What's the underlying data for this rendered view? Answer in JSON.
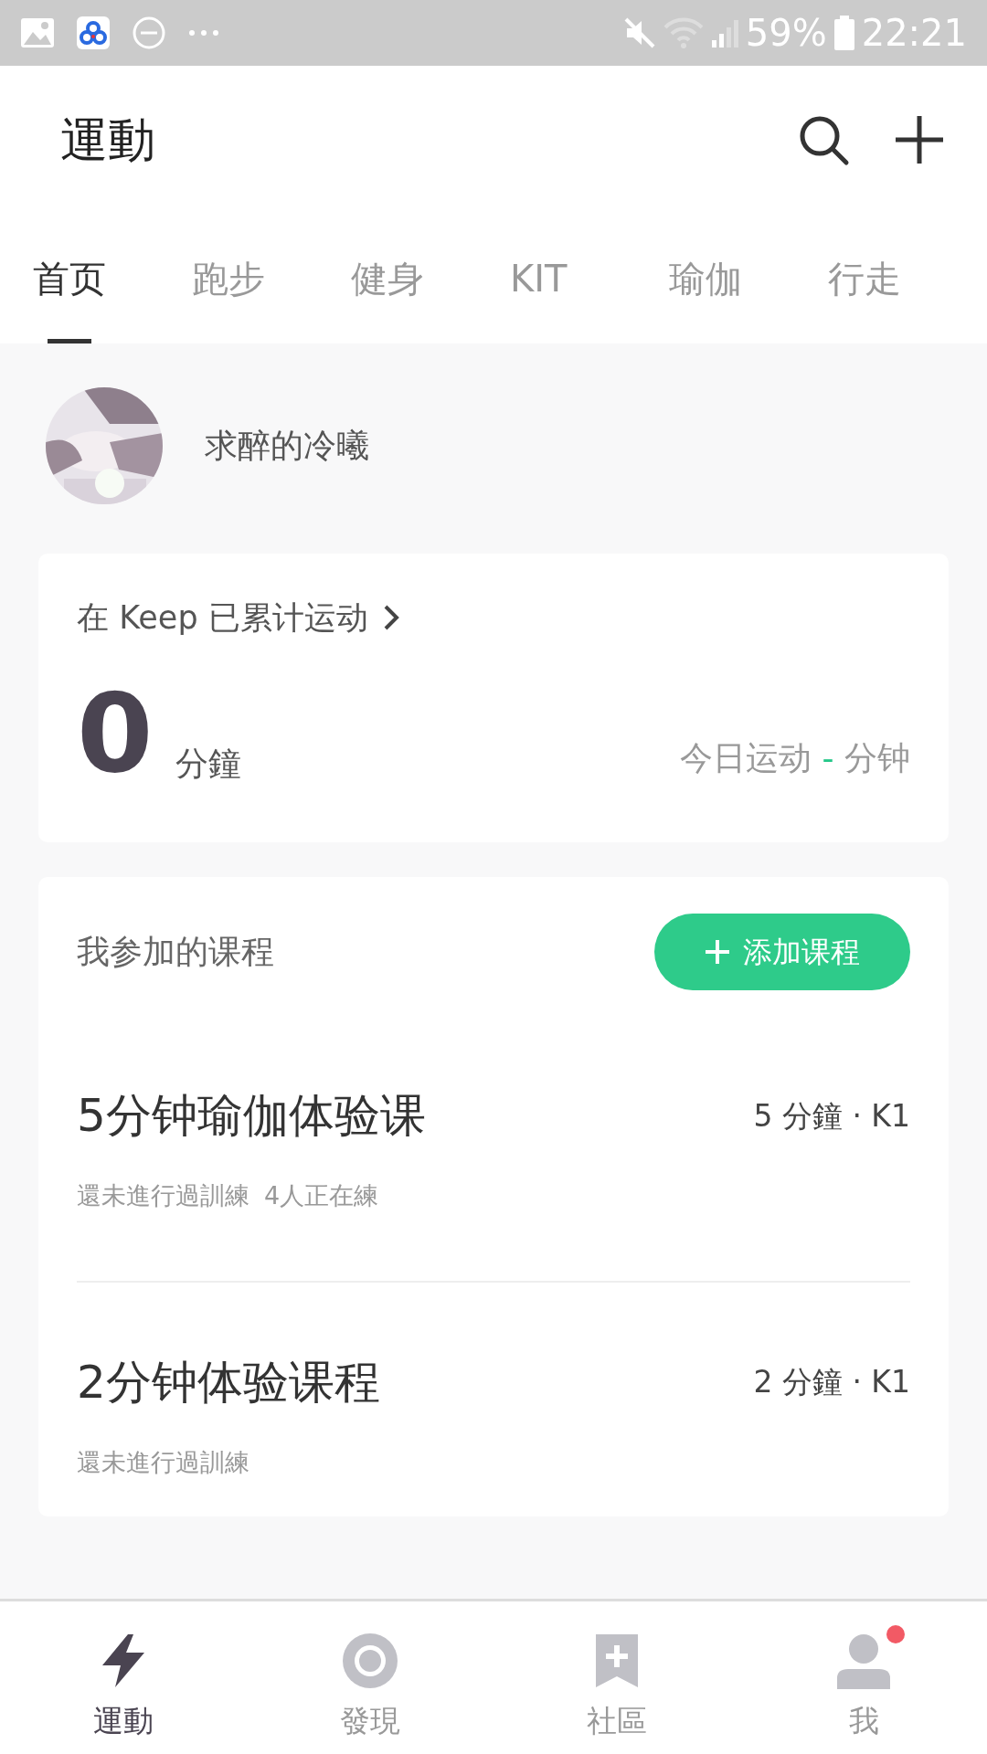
{
  "status_bar": {
    "battery": "59%",
    "time": "22:21"
  },
  "header": {
    "title": "運動"
  },
  "tabs": [
    {
      "label": "首页",
      "selected": true
    },
    {
      "label": "跑步",
      "selected": false
    },
    {
      "label": "健身",
      "selected": false
    },
    {
      "label": "KIT",
      "selected": false
    },
    {
      "label": "瑜伽",
      "selected": false
    },
    {
      "label": "行走",
      "selected": false
    }
  ],
  "profile": {
    "name": "求醉的冷曦"
  },
  "summary": {
    "title": "在 Keep 已累计运动",
    "total": "0",
    "unit": "分鐘",
    "today_prefix": "今日运动",
    "today_value": "-",
    "today_unit": "分钟"
  },
  "courses": {
    "title": "我参加的课程",
    "add_button": "添加课程",
    "items": [
      {
        "name": "5分钟瑜伽体验课",
        "meta": "5 分鐘 · K1",
        "status": "還未進行過訓練",
        "participants": "4人正在練"
      },
      {
        "name": "2分钟体验课程",
        "meta": "2 分鐘 · K1",
        "status": "還未進行過訓練"
      }
    ]
  },
  "bottom_nav": [
    {
      "label": "運動",
      "kind": "bolt",
      "selected": true,
      "badge": false
    },
    {
      "label": "發現",
      "kind": "discover",
      "selected": false,
      "badge": false
    },
    {
      "label": "社區",
      "kind": "community",
      "selected": false,
      "badge": false
    },
    {
      "label": "我",
      "kind": "me",
      "selected": false,
      "badge": true
    }
  ]
}
